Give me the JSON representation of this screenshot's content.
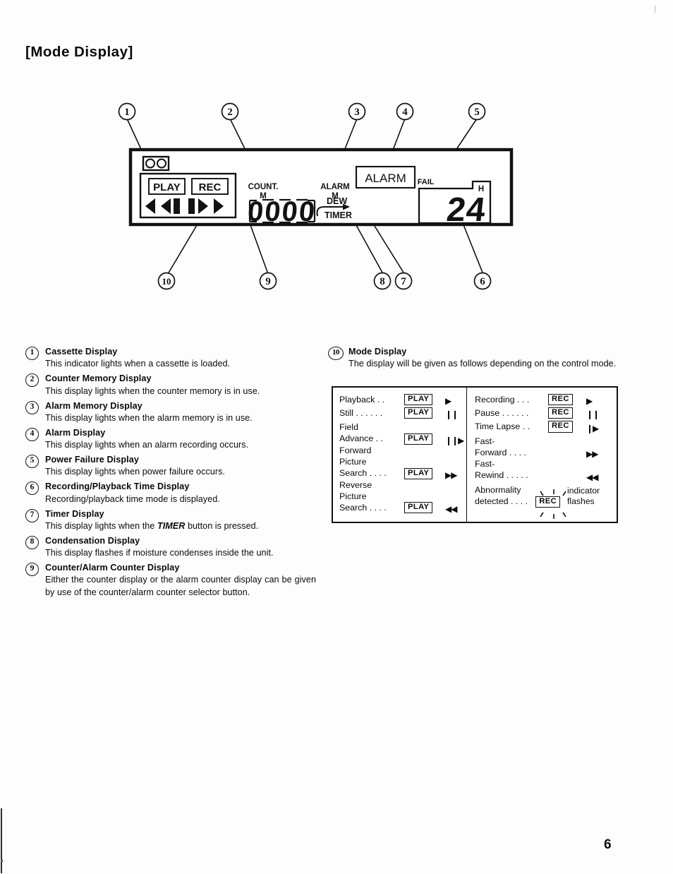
{
  "section_title": "[Mode Display]",
  "page_number": "6",
  "diagram": {
    "callouts_top": [
      "1",
      "2",
      "3",
      "4",
      "5"
    ],
    "callouts_bottom": [
      "10",
      "9",
      "8",
      "7",
      "6"
    ],
    "panel_labels": {
      "play": "PLAY",
      "rec": "REC",
      "count_m_line1": "COUNT.",
      "count_m_line2": "M",
      "alarm_m_line1": "ALARM",
      "alarm_m_line2": "M",
      "alarm_box": "ALARM",
      "pw_fail": "PW. FAIL",
      "dew": "DEW",
      "timer": "TIMER",
      "counter_value": "0000",
      "time_value": "24",
      "time_unit": "H"
    }
  },
  "descriptions_left": [
    {
      "num": "1",
      "title": "Cassette Display",
      "body": "This indicator lights when a cassette is loaded."
    },
    {
      "num": "2",
      "title": "Counter Memory Display",
      "body": "This display lights when the counter memory is in use."
    },
    {
      "num": "3",
      "title": "Alarm Memory Display",
      "body": "This display lights when the alarm memory is in use."
    },
    {
      "num": "4",
      "title": "Alarm Display",
      "body": "This display lights when an alarm recording occurs."
    },
    {
      "num": "5",
      "title": "Power Failure Display",
      "body": "This display lights when power failure occurs."
    },
    {
      "num": "6",
      "title": "Recording/Playback Time Display",
      "body": "Recording/playback time mode is displayed."
    },
    {
      "num": "7",
      "title": "Timer Display",
      "body_before": "This display lights when the ",
      "body_em": "TIMER",
      "body_after": " button is pressed."
    },
    {
      "num": "8",
      "title": "Condensation Display",
      "body": "This display flashes if moisture condenses inside the unit."
    },
    {
      "num": "9",
      "title": "Counter/Alarm Counter Display",
      "body": "Either the counter display or the alarm counter display can be given by use of the counter/alarm counter selector button."
    }
  ],
  "descriptions_right": {
    "num": "10",
    "title": "Mode Display",
    "body": "The display will be given as follows depending on the control mode."
  },
  "mode_table": {
    "left_column": [
      {
        "label": "Playback . .",
        "tag": "PLAY",
        "symbol": "▶",
        "multiline": false
      },
      {
        "label": "Still . . . . . .",
        "tag": "PLAY",
        "symbol": "❙❙",
        "multiline": false
      },
      {
        "label": "Field\nAdvance . .",
        "tag": "PLAY",
        "symbol": "❙❙▶",
        "multiline": true
      },
      {
        "label": "Forward\nPicture\nSearch . . . .",
        "tag": "PLAY",
        "symbol": "▶▶",
        "multiline": true
      },
      {
        "label": "Reverse\nPicture\nSearch . . . .",
        "tag": "PLAY",
        "symbol": "◀◀",
        "multiline": true
      }
    ],
    "right_column": [
      {
        "label": "Recording . . .",
        "tag": "REC",
        "symbol": "▶",
        "multiline": false
      },
      {
        "label": "Pause . . . . . .",
        "tag": "REC",
        "symbol": "❙❙",
        "multiline": false
      },
      {
        "label": "Time Lapse . .",
        "tag": "REC",
        "symbol": "❙▶",
        "multiline": false
      },
      {
        "label": "Fast-\nForward . . . .",
        "tag": "",
        "symbol": "▶▶",
        "multiline": true
      },
      {
        "label": "Fast-\nRewind . . . . .",
        "tag": "",
        "symbol": "◀◀",
        "multiline": true
      }
    ],
    "abnormality": {
      "label": "Abnormality\ndetected . . . .",
      "tag": "REC",
      "note": "indicator\nflashes"
    }
  }
}
